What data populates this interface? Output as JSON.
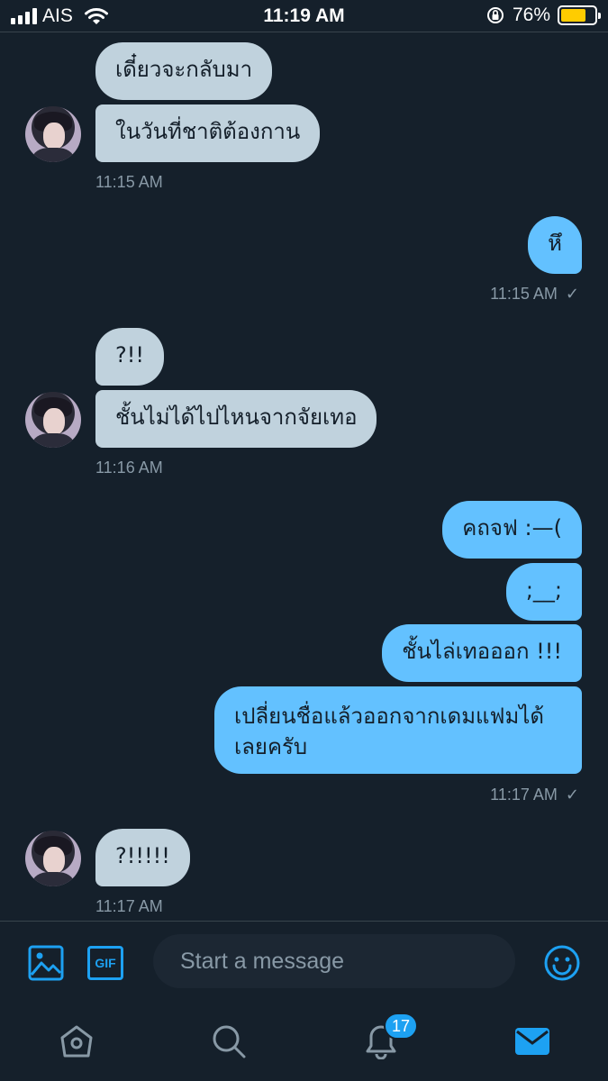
{
  "status_bar": {
    "carrier": "AIS",
    "time": "11:19 AM",
    "battery_percent": "76%",
    "battery_level": 0.76,
    "battery_color": "#ffcc00"
  },
  "messages": {
    "g1": {
      "m1": "เดี๋ยวจะกลับมา",
      "m2": "ในวันที่ชาติต้องกาน",
      "time": "11:15 AM"
    },
    "g2": {
      "m1": "หึ",
      "time": "11:15 AM",
      "check": "✓"
    },
    "g3": {
      "m1": "?!!",
      "m2": "ชั้นไม่ได้ไปไหนจากจัยเทอ",
      "time": "11:16 AM"
    },
    "g4": {
      "m1": "คถจฟ :—(",
      "m2": ";__;",
      "m3": "ชั้นไล่เทอออก !!!",
      "m4a": "เปลี่ยนชื่อแล้วออกจากเดมแฟมได้",
      "m4b": "เลยครับ",
      "time": "11:17 AM",
      "check": "✓"
    },
    "g5": {
      "m1": "?!!!!!",
      "time": "11:17 AM"
    }
  },
  "composer": {
    "placeholder": "Start a message",
    "gif_label": "GIF",
    "icons": [
      "image-icon",
      "gif-icon",
      "emoji-icon"
    ]
  },
  "tabbar": {
    "notification_count": "17",
    "icons": [
      "home-icon",
      "search-icon",
      "bell-icon",
      "mail-icon"
    ]
  },
  "colors": {
    "background": "#15202b",
    "incoming_bubble": "#c0d2dd",
    "outgoing_bubble": "#63c1ff",
    "accent": "#1da1f2",
    "timestamp": "#8899a6"
  }
}
